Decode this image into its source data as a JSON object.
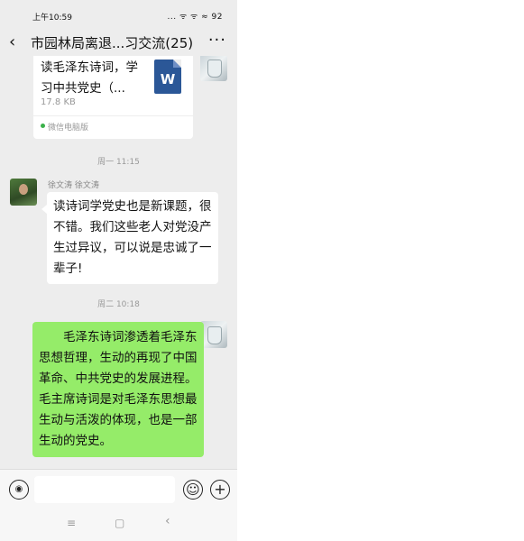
{
  "status_bar": {
    "time": "上午10:59",
    "icons": "... ᯤ ᯤ ≈ 92"
  },
  "header": {
    "back_icon": "‹",
    "title": "市园林局离退...习交流(25)",
    "more_icon": "···"
  },
  "messages": {
    "file": {
      "name": "读毛泽东诗词，学习中共党史（...",
      "size": "17.8 KB",
      "source": "微信电脑版",
      "icon_letter": "W"
    },
    "time1": "周一 11:15",
    "msg1": {
      "sender": "徐文涛 徐文涛",
      "text": "读诗词学党史也是新课题，很不错。我们这些老人对党没产生过异议，可以说是忠诚了一辈子!"
    },
    "time2": "周二 10:18",
    "msg2": {
      "text": "毛泽东诗词渗透着毛泽东思想哲理，生动的再现了中国革命、中共党史的发展进程。毛主席诗词是对毛泽东思想最生动与活泼的体现，也是一部生动的党史。"
    }
  },
  "input_bar": {
    "voice_icon": "◉",
    "emoji_icon": "☺",
    "plus_icon": "+"
  },
  "nav_bar": {
    "menu_icon": "≡",
    "home_icon": "▢",
    "back_icon": "‹"
  },
  "colors": {
    "bubble_self": "#95ec69",
    "chat_bg": "#ededed",
    "word_blue": "#2b5797"
  }
}
